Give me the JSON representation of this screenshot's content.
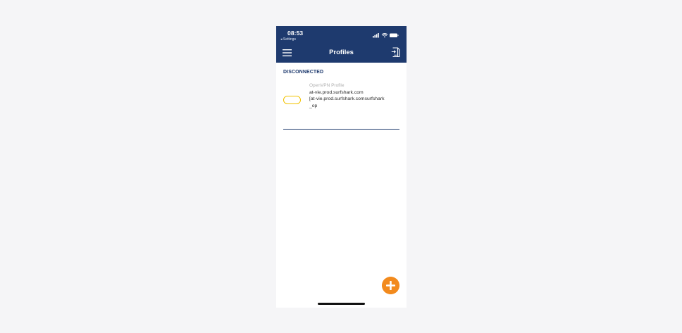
{
  "status_bar": {
    "time": "08:53",
    "back_label": "◂ Settings"
  },
  "nav": {
    "title": "Profiles",
    "menu_icon": "hamburger-menu-icon",
    "import_icon": "import-profile-icon"
  },
  "section": {
    "title": "DISCONNECTED"
  },
  "profiles": [
    {
      "type": "OpenVPN Profile",
      "name": "at-vie.prod.surfshark.com",
      "detail": "[at-vie.prod.surfshark.comsurfshark_op",
      "connected": false
    }
  ],
  "fab": {
    "icon": "plus-icon"
  },
  "colors": {
    "header_bg": "#1e3a6e",
    "accent_orange": "#f28a1d",
    "toggle_border": "#f2c200"
  }
}
